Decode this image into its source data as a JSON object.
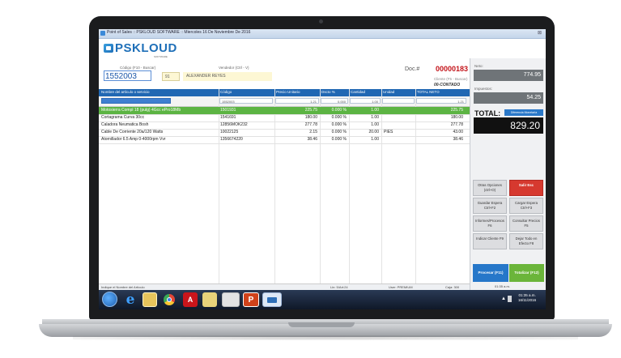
{
  "window": {
    "title": "Point of Sales :: PSKLOUD SOFTWARE :: Miercoles 16 De Noviembre De 2016"
  },
  "brand": {
    "name": "PSKLOUD",
    "sub": "SOFTWARE"
  },
  "header": {
    "code_label": "Código (F10 - Buscar)",
    "code_value": "1552003",
    "vendor_label": "Vendedor (Ctrl - V)",
    "vendor_code": "91",
    "vendor_name": "ALEXANDER REYES",
    "doc_label": "Doc.#",
    "doc_number": "00000183",
    "client_label": "Cliente (F5 - Buscar)",
    "client_value": "00-CONTADO"
  },
  "grid": {
    "columns": [
      "Nombre del artículo o servicio",
      "Código",
      "Precio Unitario",
      "Dscto %",
      "Cantidad",
      "Unidad",
      "TOTAL NETO"
    ],
    "edit_row": {
      "name": "",
      "code": "1552003",
      "price": "1.21",
      "disc": "0.000",
      "qty": "1.00",
      "unit": "",
      "total": "1.21"
    },
    "rows": [
      {
        "name": "Motosierra Compl 18 (pulg) 4Gcc ePro18Mb",
        "code": "1501931",
        "price": "225.75",
        "disc": "0.000 %",
        "qty": "1.00",
        "unit": "",
        "total": "225.75",
        "selected": true
      },
      {
        "name": "Cortagrama Curva 30cc",
        "code": "1541691",
        "price": "180.00",
        "disc": "0.000 %",
        "qty": "1.00",
        "unit": "",
        "total": "180.00",
        "selected": false
      },
      {
        "name": "Caladora Neumatica Bosh",
        "code": "12856MOK232",
        "price": "277.78",
        "disc": "0.000 %",
        "qty": "1.00",
        "unit": "",
        "total": "277.78",
        "selected": false
      },
      {
        "name": "Cable De Corriente 20a/120 Watts",
        "code": "10022125",
        "price": "2.15",
        "disc": "0.000 %",
        "qty": "20.00",
        "unit": "PIES",
        "total": "43.00",
        "selected": false
      },
      {
        "name": "Atornillador 6.5 Amp 0-4000rpm Vvr",
        "code": "1356674220",
        "price": "38.46",
        "disc": "0.000 %",
        "qty": "1.00",
        "unit": "",
        "total": "38.46",
        "selected": false
      }
    ]
  },
  "status": {
    "hint": "Indique el Nombre del Artículo",
    "line": "Lin: 5/Art:24",
    "user": "User: PREMIUM",
    "caja": "Caja: 300",
    "time": "01:35 a.m."
  },
  "summary": {
    "neto_label": "Neto:",
    "neto_value": "774.95",
    "imp_label": "Impuestos:",
    "imp_value": "54.25",
    "total_label": "TOTAL:",
    "dif_label": "Diferencia Monetaria",
    "total_value": "829.20"
  },
  "actions": {
    "otras": "Otras Opciones (ctrl+O)",
    "salir": "Salir Esc",
    "guardar": "Guardar Espera Ctrl+F2",
    "cargar": "Cargar Espera Ctrl+F3",
    "informes": "Informes/Procesos F6",
    "consultar": "Consultar Precios F5",
    "indicar": "Indicar Cliente F9",
    "dejar": "Dejar Todo en Efecto F8",
    "procesar": "Procesar (F11)",
    "totalizar": "Totalizar (F12)"
  },
  "taskbar": {
    "ie": "e",
    "pdf": "A",
    "ppt": "P",
    "clock_time": "01:35 a.m.",
    "clock_date": "16/11/2016"
  }
}
